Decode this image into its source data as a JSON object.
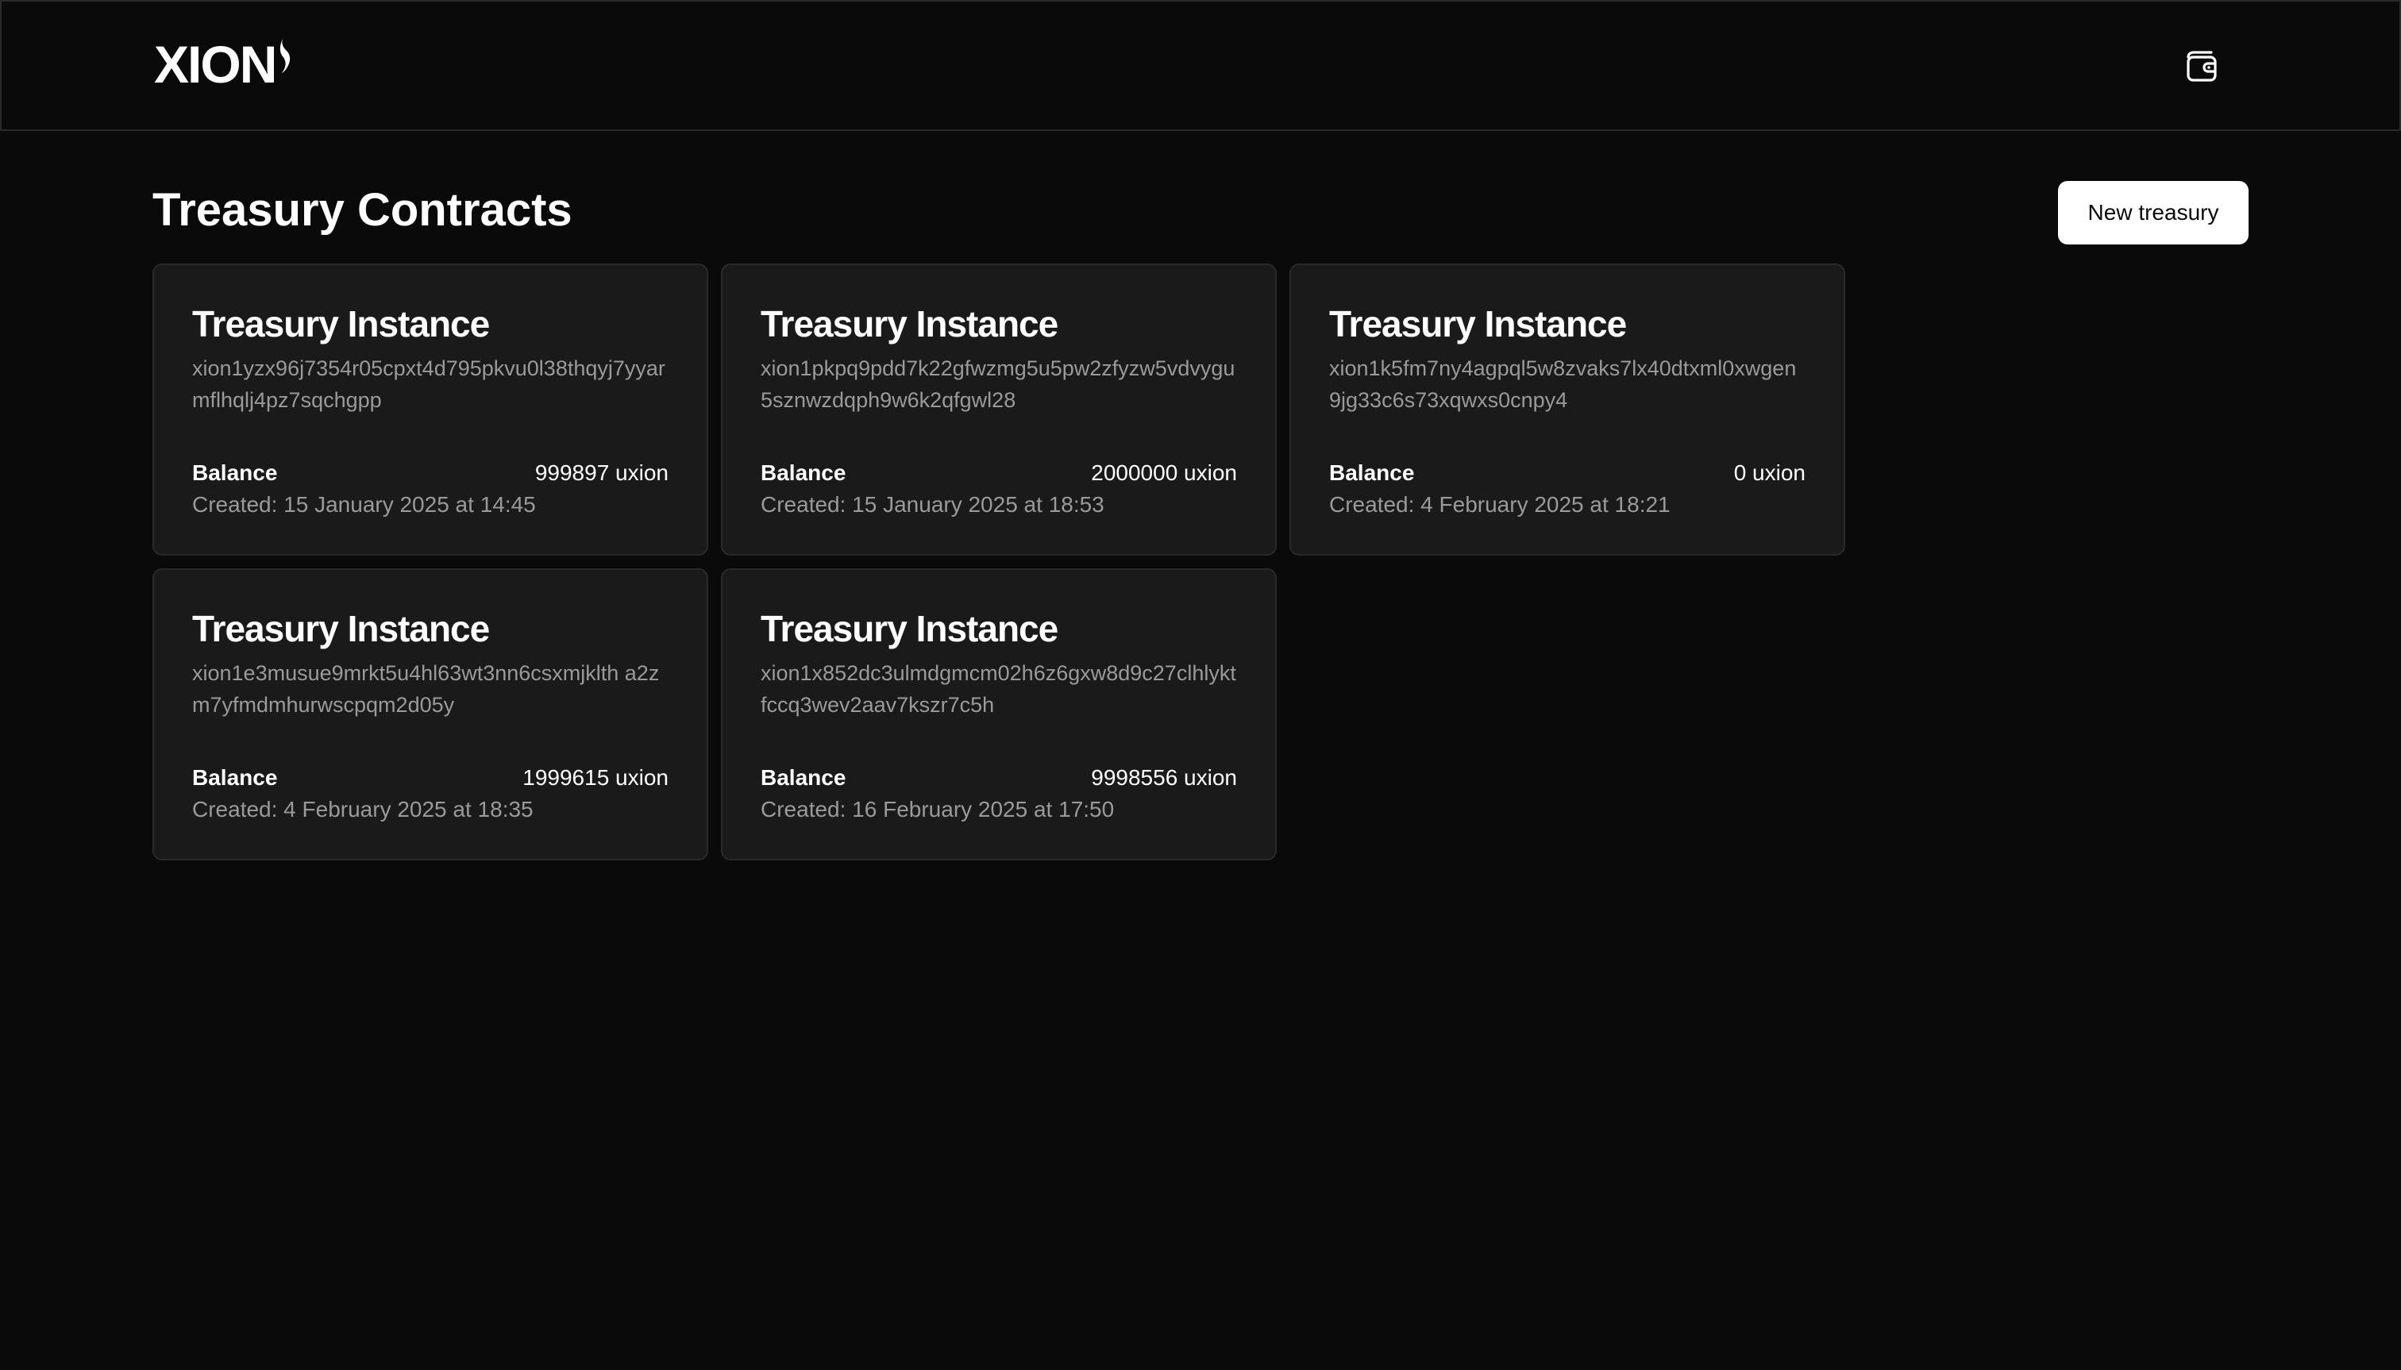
{
  "header": {
    "logo_text": "XION",
    "logo_icon": "flame-icon",
    "wallet_icon": "wallet-icon"
  },
  "main": {
    "title": "Treasury Contracts",
    "new_button_label": "New treasury"
  },
  "cards": [
    {
      "title": "Treasury Instance",
      "address": "xion1yzx96j7354r05cpxt4d795pkvu0l38thqyj7yyarmflhqlj4pz7sqchgpp",
      "balance_label": "Balance",
      "balance_value": "999897 uxion",
      "created": "Created: 15 January 2025 at 14:45"
    },
    {
      "title": "Treasury Instance",
      "address": "xion1pkpq9pdd7k22gfwzmg5u5pw2zfyzw5vdvygu5sznwzdqph9w6k2qfgwl28",
      "balance_label": "Balance",
      "balance_value": "2000000 uxion",
      "created": "Created: 15 January 2025 at 18:53"
    },
    {
      "title": "Treasury Instance",
      "address": "xion1k5fm7ny4agpql5w8zvaks7lx40dtxml0xwgen9jg33c6s73xqwxs0cnpy4",
      "balance_label": "Balance",
      "balance_value": "0 uxion",
      "created": "Created: 4 February 2025 at 18:21"
    },
    {
      "title": "Treasury Instance",
      "address": "xion1e3musue9mrkt5u4hl63wt3nn6csxmjklth a2zm7yfmdmhurwscpqm2d05y",
      "balance_label": "Balance",
      "balance_value": "1999615 uxion",
      "created": "Created: 4 February 2025 at 18:35"
    },
    {
      "title": "Treasury Instance",
      "address": "xion1x852dc3ulmdgmcm02h6z6gxw8d9c27clhlyktfccq3wev2aav7kszr7c5h",
      "balance_label": "Balance",
      "balance_value": "9998556 uxion",
      "created": "Created: 16 February 2025 at 17:50"
    }
  ],
  "colors": {
    "background": "#0a0a0a",
    "card_background": "#1a1a1a",
    "card_border": "#2a2a2a",
    "muted_text": "#9a9a9a",
    "button_background": "#ffffff"
  }
}
